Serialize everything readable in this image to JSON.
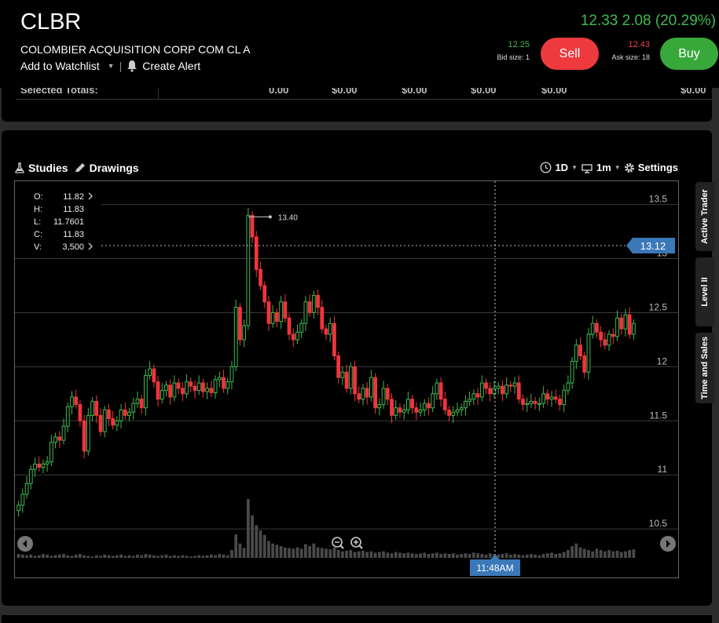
{
  "header": {
    "symbol": "CLBR",
    "company": "COLOMBIER ACQUISITION CORP COM CL A",
    "watchlist": "Add to Watchlist",
    "alert": "Create Alert",
    "quote": "12.33 2.08 (20.29%)",
    "bid_price": "12.25",
    "bid_size": "Bid size: 1",
    "ask_price": "12.43",
    "ask_size": "Ask size: 18",
    "sell": "Sell",
    "buy": "Buy"
  },
  "totals": {
    "label": "Selected Totals:",
    "values": [
      "0.00",
      "$0.00",
      "$0.00",
      "$0.00",
      "$0.00",
      "$0.00"
    ]
  },
  "toolbar": {
    "studies": "Studies",
    "drawings": "Drawings",
    "range": "1D",
    "interval": "1m",
    "settings": "Settings"
  },
  "ohlc": {
    "o_label": "O:",
    "o": "11.82",
    "h_label": "H:",
    "h": "11.83",
    "l_label": "L:",
    "l": "11.7601",
    "c_label": "C:",
    "c": "11.83",
    "v_label": "V:",
    "v": "3,500"
  },
  "side_tabs": [
    "Active Trader",
    "Level II",
    "Time and Sales"
  ],
  "chart_data": {
    "type": "candlestick",
    "y_ticks": [
      "13.5",
      "13",
      "12.5",
      "12",
      "11.5",
      "11",
      "10.5"
    ],
    "ylim": [
      10.45,
      13.57
    ],
    "grid": true,
    "last_price": "13.12",
    "high_marker": "13.40",
    "crosshair_time": "11:48AM",
    "colors": {
      "up": "#3fb950",
      "down": "#f0343c",
      "tag": "#3b78b8"
    },
    "close": [
      10.72,
      10.82,
      10.92,
      11.05,
      11.1,
      11.07,
      11.1,
      11.12,
      11.3,
      11.35,
      11.32,
      11.45,
      11.63,
      11.72,
      11.65,
      11.5,
      11.22,
      11.55,
      11.68,
      11.55,
      11.4,
      11.6,
      11.52,
      11.46,
      11.5,
      11.6,
      11.55,
      11.58,
      11.66,
      11.7,
      11.62,
      11.92,
      11.98,
      11.86,
      11.7,
      11.78,
      11.83,
      11.72,
      11.85,
      11.8,
      11.75,
      11.86,
      11.82,
      11.78,
      11.85,
      11.77,
      11.8,
      11.76,
      11.88,
      11.9,
      11.8,
      11.86,
      12.0,
      12.55,
      12.25,
      12.38,
      13.4,
      13.2,
      12.9,
      12.75,
      12.6,
      12.4,
      12.5,
      12.42,
      12.6,
      12.45,
      12.3,
      12.25,
      12.32,
      12.4,
      12.6,
      12.5,
      12.66,
      12.55,
      12.35,
      12.3,
      12.4,
      12.1,
      11.9,
      11.95,
      11.8,
      12.0,
      11.75,
      11.7,
      11.8,
      11.72,
      11.9,
      11.62,
      11.65,
      11.8,
      11.7,
      11.55,
      11.62,
      11.58,
      11.6,
      11.7,
      11.62,
      11.58,
      11.6,
      11.66,
      11.62,
      11.75,
      11.85,
      11.7,
      11.6,
      11.55,
      11.58,
      11.6,
      11.62,
      11.68,
      11.7,
      11.75,
      11.72,
      11.85,
      11.8,
      11.75,
      11.8,
      11.82,
      11.75,
      11.83,
      11.82,
      11.85,
      11.7,
      11.65,
      11.66,
      11.68,
      11.66,
      11.66,
      11.75,
      11.7,
      11.72,
      11.7,
      11.65,
      11.78,
      11.85,
      12.05,
      12.2,
      12.1,
      11.95,
      12.3,
      12.4,
      12.32,
      12.25,
      12.2,
      12.3,
      12.28,
      12.45,
      12.35,
      12.48,
      12.3,
      12.4
    ],
    "volume": [
      0.6,
      0.5,
      0.4,
      0.5,
      0.3,
      0.4,
      0.6,
      0.5,
      0.3,
      0.4,
      0.5,
      0.6,
      0.4,
      0.3,
      0.5,
      0.6,
      0.4,
      0.3,
      0.2,
      0.4,
      0.3,
      0.5,
      0.4,
      0.3,
      0.4,
      0.5,
      0.3,
      0.4,
      0.3,
      0.5,
      0.4,
      0.6,
      0.5,
      0.4,
      0.3,
      0.4,
      0.5,
      0.3,
      0.4,
      0.3,
      0.4,
      0.3,
      0.2,
      0.3,
      0.4,
      0.3,
      0.4,
      0.5,
      0.4,
      0.6,
      0.5,
      0.4,
      1.2,
      3.6,
      2.2,
      1.5,
      9.0,
      6.5,
      5.0,
      4.2,
      3.5,
      2.6,
      2.2,
      2.0,
      1.8,
      1.6,
      1.5,
      1.4,
      1.6,
      1.4,
      2.1,
      1.8,
      2.2,
      1.6,
      1.5,
      1.4,
      1.3,
      1.6,
      1.2,
      1.0,
      1.1,
      1.2,
      0.9,
      1.0,
      1.1,
      0.9,
      1.0,
      0.8,
      0.9,
      1.0,
      0.8,
      0.7,
      0.9,
      0.8,
      0.7,
      0.8,
      0.7,
      0.6,
      0.7,
      0.8,
      0.6,
      0.7,
      0.8,
      0.6,
      0.7,
      0.6,
      0.7,
      0.5,
      0.6,
      0.7,
      0.6,
      0.8,
      0.7,
      0.6,
      0.5,
      0.7,
      0.6,
      0.5,
      0.6,
      0.7,
      0.5,
      0.6,
      0.5,
      0.4,
      0.5,
      0.6,
      0.5,
      0.4,
      0.6,
      0.7,
      0.8,
      0.6,
      0.7,
      0.9,
      1.2,
      1.8,
      2.2,
      1.6,
      1.4,
      1.2,
      1.0,
      1.4,
      1.2,
      1.0,
      1.2,
      1.0,
      1.1,
      0.9,
      1.0,
      1.2,
      1.3
    ]
  }
}
